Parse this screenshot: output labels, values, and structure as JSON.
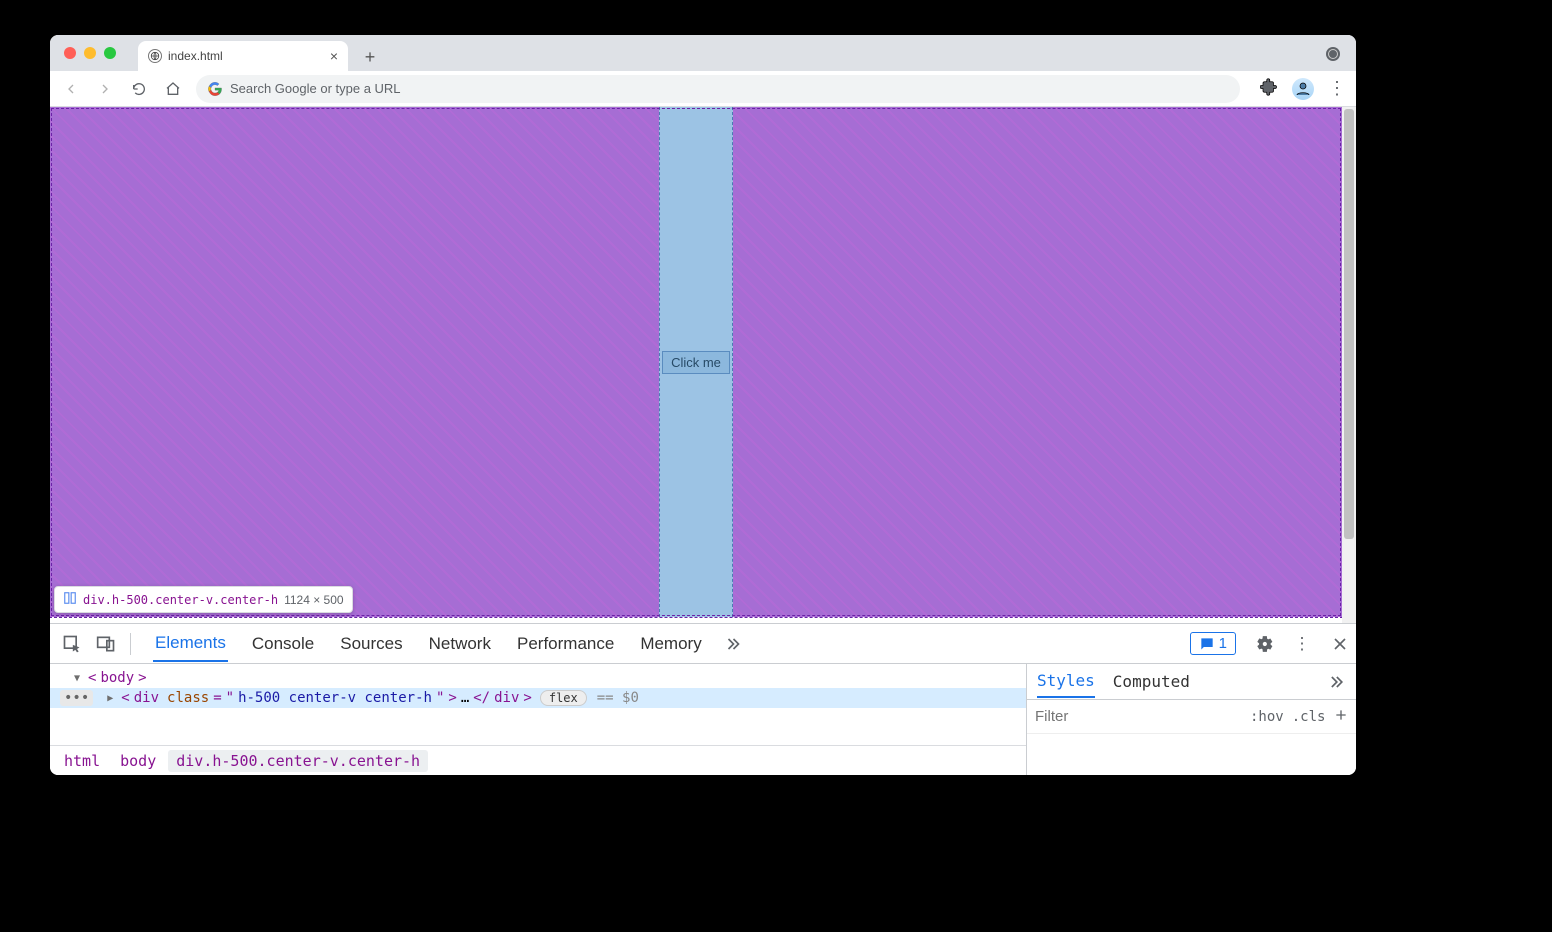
{
  "tab": {
    "title": "index.html"
  },
  "omnibox": {
    "placeholder": "Search Google or type a URL"
  },
  "page": {
    "button_label": "Click me",
    "tooltip_selector": "div.h-500.center-v.center-h",
    "tooltip_dims": "1124 × 500"
  },
  "devtools": {
    "tabs": [
      "Elements",
      "Console",
      "Sources",
      "Network",
      "Performance",
      "Memory"
    ],
    "active_tab": "Elements",
    "issues_count": "1",
    "dom": {
      "body_open": "body",
      "sel_tag": "div",
      "sel_attr_name": "class",
      "sel_attr_val": "h-500 center-v center-h",
      "flex_badge": "flex",
      "eq_var": "== $0"
    },
    "breadcrumbs": [
      "html",
      "body",
      "div.h-500.center-v.center-h"
    ],
    "styles": {
      "tabs": [
        "Styles",
        "Computed"
      ],
      "active": "Styles",
      "filter_placeholder": "Filter",
      "hov": ":hov",
      "cls": ".cls"
    }
  }
}
